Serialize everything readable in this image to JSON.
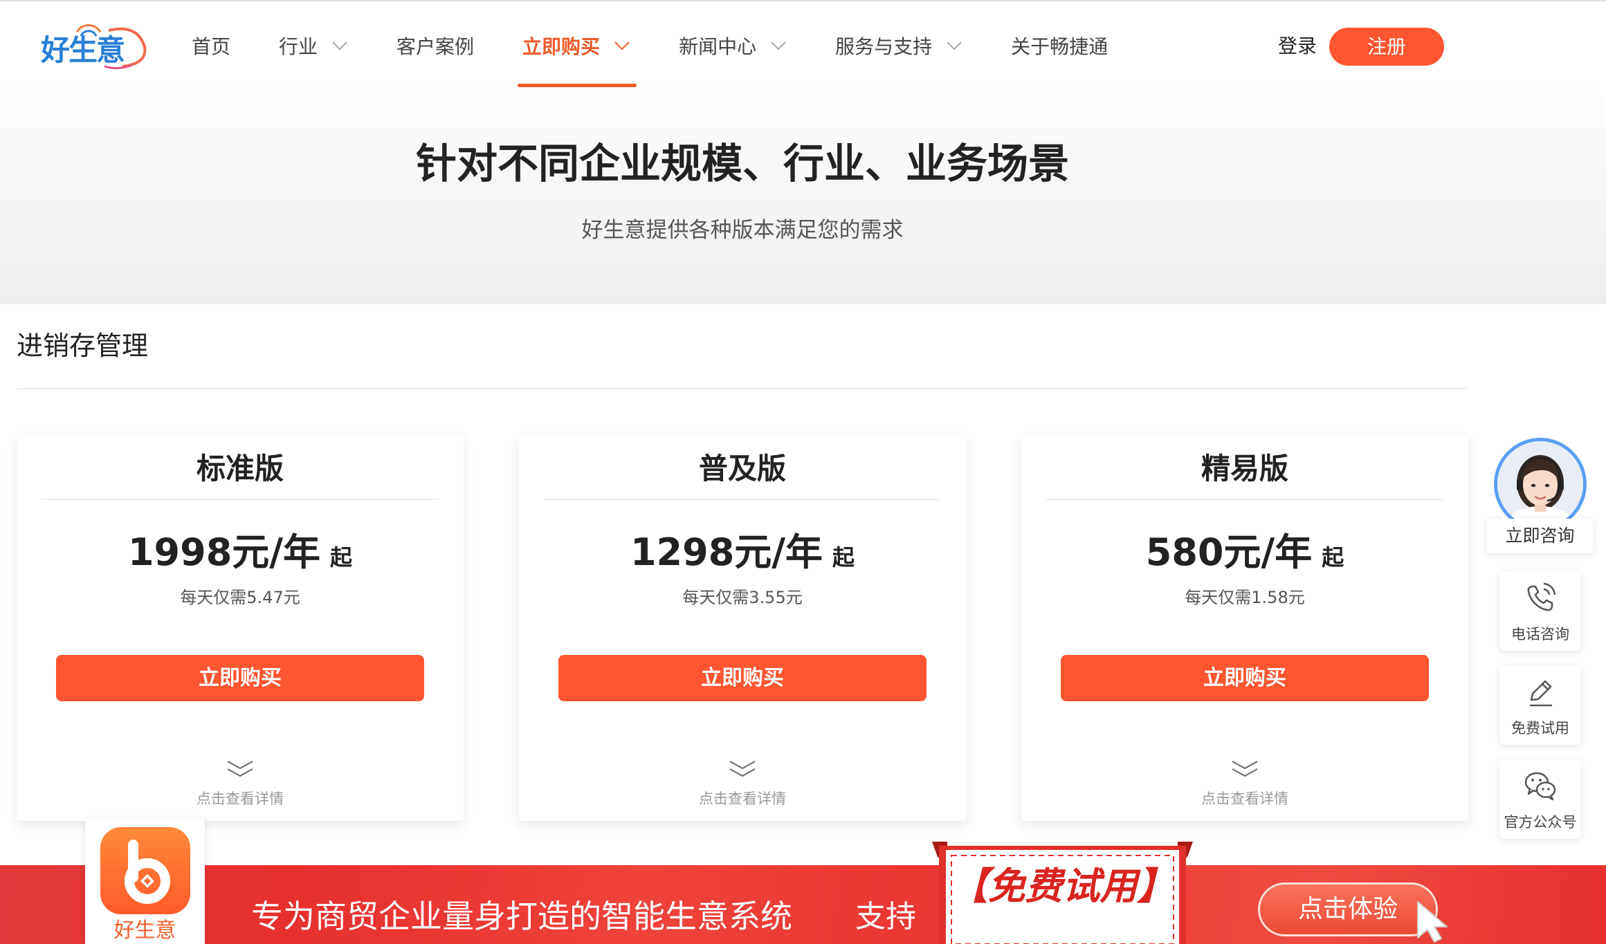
{
  "logo": {
    "text": "好生意"
  },
  "nav": {
    "items": [
      {
        "label": "首页",
        "dropdown": false,
        "active": false
      },
      {
        "label": "行业",
        "dropdown": true,
        "active": false
      },
      {
        "label": "客户案例",
        "dropdown": false,
        "active": false
      },
      {
        "label": "立即购买",
        "dropdown": true,
        "active": true
      },
      {
        "label": "新闻中心",
        "dropdown": true,
        "active": false
      },
      {
        "label": "服务与支持",
        "dropdown": true,
        "active": false
      },
      {
        "label": "关于畅捷通",
        "dropdown": false,
        "active": false
      }
    ],
    "login_label": "登录",
    "register_label": "注册"
  },
  "hero": {
    "title": "针对不同企业规模、行业、业务场景",
    "subtitle": "好生意提供各种版本满足您的需求"
  },
  "section": {
    "title": "进销存管理"
  },
  "plans": [
    {
      "name": "标准版",
      "price": "1998元/年",
      "price_suffix": "起",
      "daily": "每天仅需5.47元",
      "buy_label": "立即购买",
      "detail_label": "点击查看详情"
    },
    {
      "name": "普及版",
      "price": "1298元/年",
      "price_suffix": "起",
      "daily": "每天仅需3.55元",
      "buy_label": "立即购买",
      "detail_label": "点击查看详情"
    },
    {
      "name": "精易版",
      "price": "580元/年",
      "price_suffix": "起",
      "daily": "每天仅需1.58元",
      "buy_label": "立即购买",
      "detail_label": "点击查看详情"
    }
  ],
  "float_bar": {
    "consult_label": "立即咨询",
    "phone_label": "电话咨询",
    "trial_label": "免费试用",
    "wechat_label": "官方公众号"
  },
  "banner": {
    "app_name": "好生意",
    "slogan": "专为商贸企业量身打造的智能生意系统",
    "support_label": "支持",
    "ribbon_text": "【免费试用】",
    "cta_label": "点击体验"
  },
  "colors": {
    "accent": "#fe5631",
    "active_nav": "#f05a28",
    "banner_red": "#e7302c",
    "avatar_border": "#5c9ef3"
  },
  "icons": {
    "nav_dropdown": "chevron-down-icon",
    "card_more": "double-chevron-down-icon",
    "phone": "phone-icon",
    "trial": "pencil-icon",
    "wechat": "wechat-icon",
    "cursor": "cursor-arrow-icon"
  }
}
